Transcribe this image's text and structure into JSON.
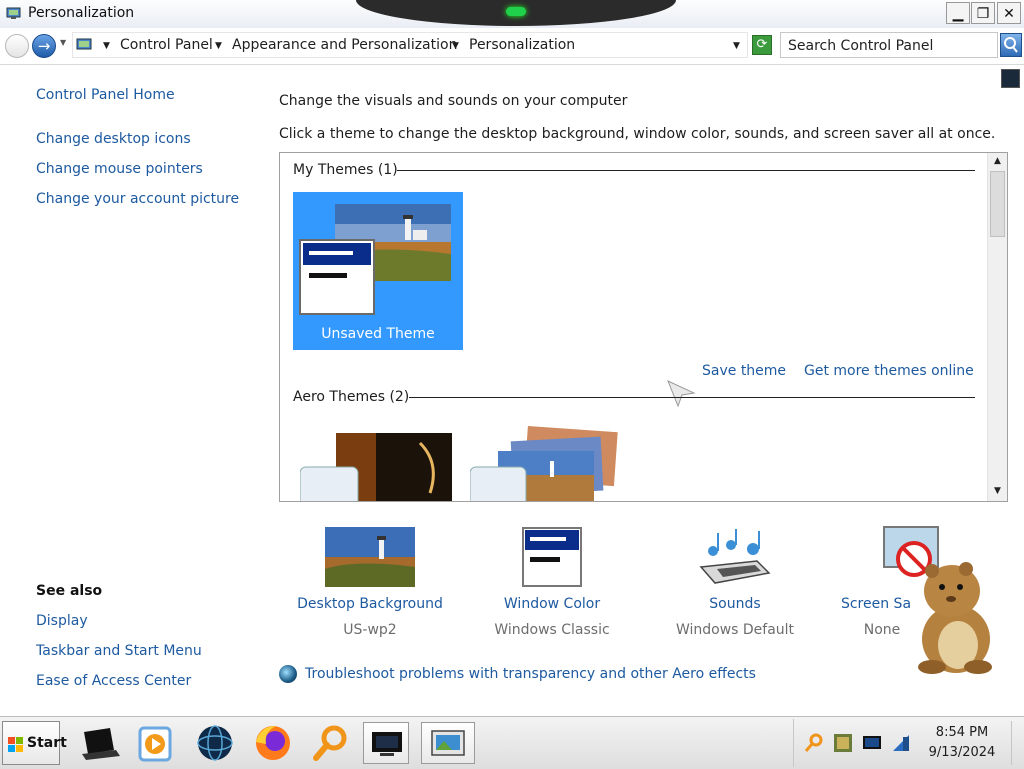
{
  "window": {
    "title": "Personalization"
  },
  "address_bar": {
    "breadcrumbs": [
      "Control Panel",
      "Appearance and Personalization",
      "Personalization"
    ],
    "search_placeholder": "Search Control Panel"
  },
  "window_controls": {
    "minimize": "▁",
    "restore": "❐",
    "close": "✕"
  },
  "sidebar": {
    "home": "Control Panel Home",
    "links": [
      "Change desktop icons",
      "Change mouse pointers",
      "Change your account picture"
    ],
    "see_also_title": "See also",
    "see_also": [
      "Display",
      "Taskbar and Start Menu",
      "Ease of Access Center"
    ]
  },
  "main": {
    "heading": "Change the visuals and sounds on your computer",
    "instructions": "Click a theme to change the desktop background, window color, sounds, and screen saver all at once.",
    "my_themes_label": "My Themes (1)",
    "unsaved_theme": "Unsaved Theme",
    "save_theme": "Save theme",
    "get_more_themes": "Get more themes online",
    "aero_themes_label": "Aero Themes (2)"
  },
  "settings": [
    {
      "label": "Desktop Background",
      "value": "US-wp2",
      "icon": "desktop-background-icon"
    },
    {
      "label": "Window Color",
      "value": "Windows Classic",
      "icon": "window-color-icon"
    },
    {
      "label": "Sounds",
      "value": "Windows Default",
      "icon": "sounds-icon"
    },
    {
      "label": "Screen Sa",
      "value": "None",
      "icon": "screen-saver-icon"
    }
  ],
  "troubleshoot": "Troubleshoot problems with transparency and other Aero effects",
  "taskbar": {
    "start_label": "Start",
    "pinned_icons": [
      "black-laptop-icon",
      "media-player-icon",
      "globe-icon",
      "firefox-icon",
      "search-magnifier-icon",
      "monitor-icon",
      "personalization-window-icon"
    ],
    "tray_icons": [
      "search-tray-icon",
      "app-tray-icon",
      "display-tray-icon",
      "network-tray-icon"
    ],
    "clock_time": "8:54 PM",
    "clock_date": "9/13/2024"
  },
  "colors": {
    "link": "#1e5aa0",
    "selection": "#3399ff",
    "muted_text": "#6d6d6d"
  }
}
